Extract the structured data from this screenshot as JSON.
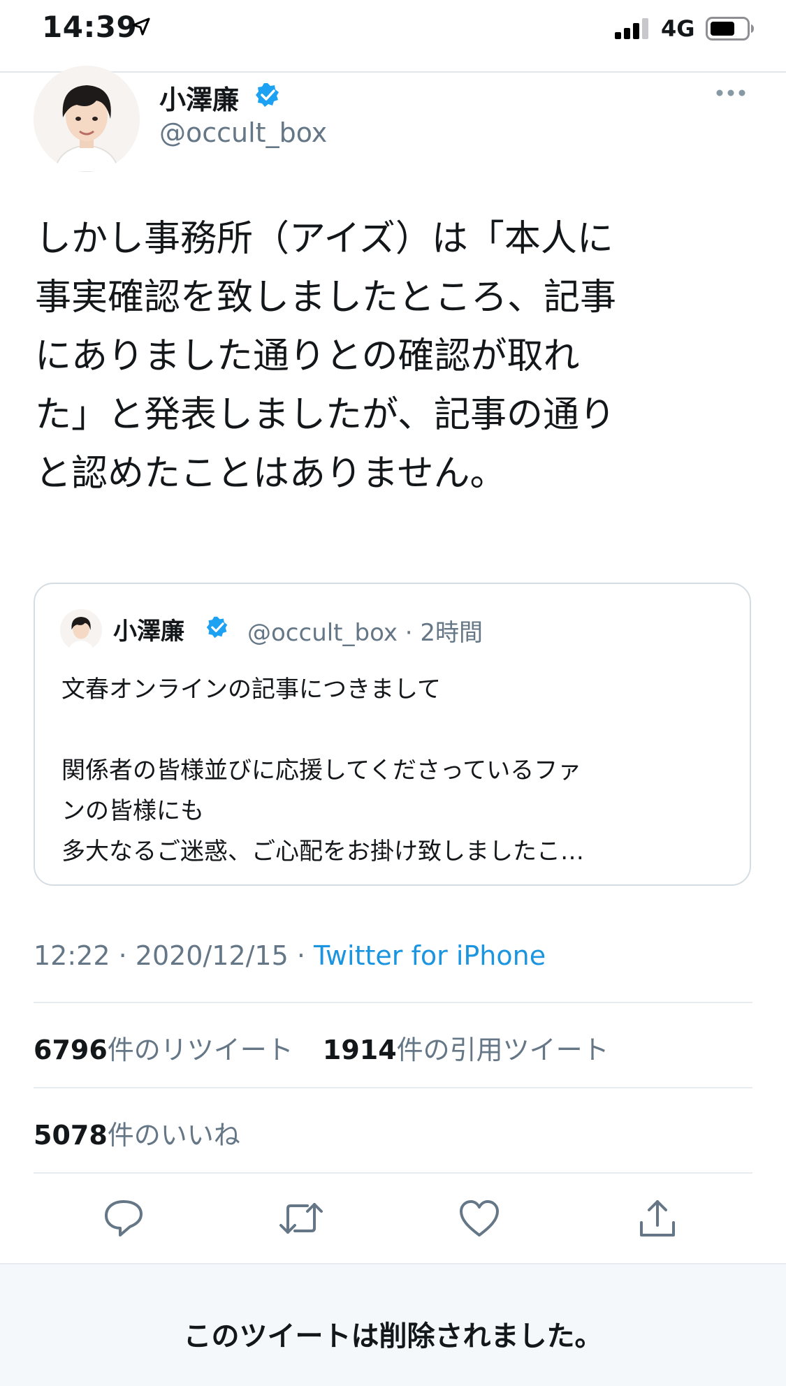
{
  "status_bar": {
    "time": "14:39",
    "network": "4G"
  },
  "author": {
    "name": "小澤廉",
    "handle": "@occult_box"
  },
  "tweet": {
    "text": "しかし事務所（アイズ）は「本人に\n事実確認を致しましたところ、記事\nにありました通りとの確認が取れ\nた」と発表しましたが、記事の通り\nと認めたことはありません。"
  },
  "quoted_tweet": {
    "name": "小澤廉",
    "handle_time": "@occult_box · 2時間",
    "text": "文春オンラインの記事につきまして\n\n関係者の皆様並びに応援してくださっているファ\nンの皆様にも\n多大なるご迷惑、ご心配をお掛け致しましたこ…"
  },
  "meta": {
    "time": "12:22",
    "separator": " · ",
    "date": "2020/12/15",
    "source": "Twitter for iPhone"
  },
  "stats": {
    "retweets_count": "6796",
    "retweets_label": "件のリツイート",
    "quotes_count": "1914",
    "quotes_label": "件の引用ツイート",
    "likes_count": "5078",
    "likes_label": "件のいいね"
  },
  "banner": {
    "text": "このツイートは削除されました。"
  },
  "icons": {
    "location": "location-arrow-icon",
    "signal": "signal-icon",
    "battery": "battery-icon",
    "verified": "verified-badge-icon",
    "more": "more-icon",
    "reply": "reply-icon",
    "retweet": "retweet-icon",
    "like": "heart-icon",
    "share": "share-icon"
  },
  "colors": {
    "text": "#14171a",
    "secondary": "#657786",
    "link": "#1b95e0",
    "verified": "#1da1f2"
  }
}
